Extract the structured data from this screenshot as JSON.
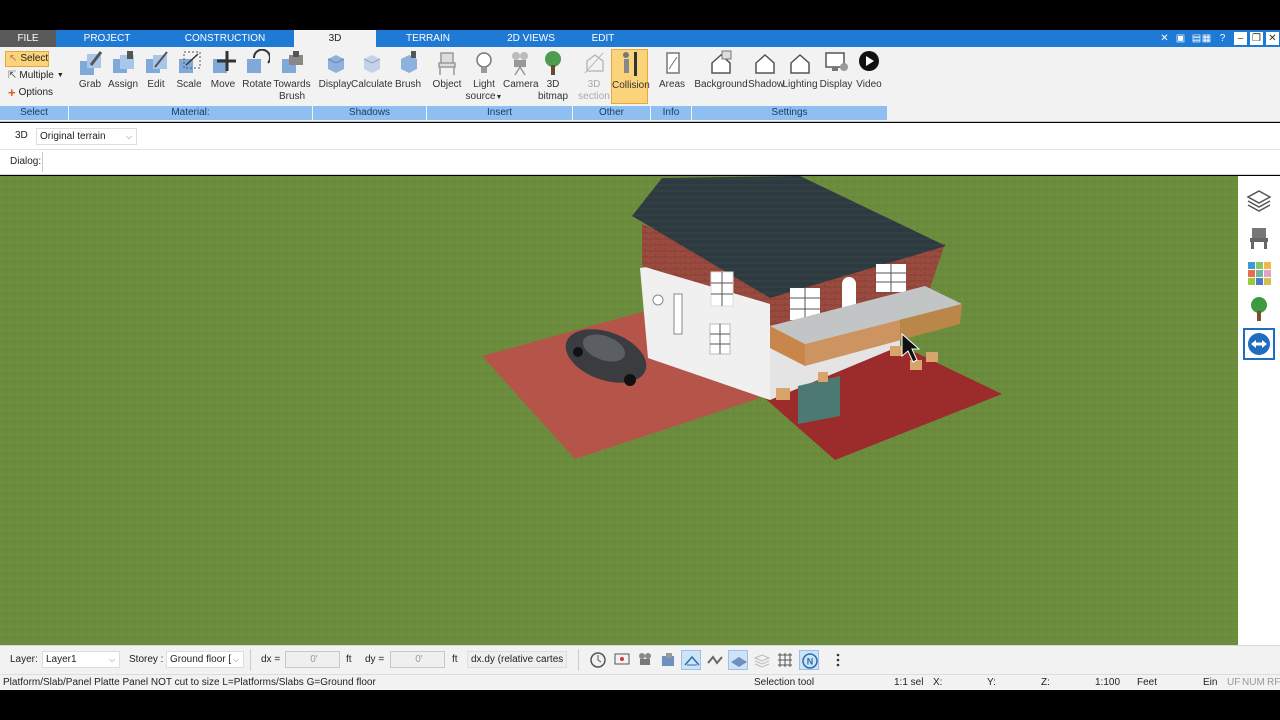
{
  "menu": {
    "tabs": [
      "FILE",
      "PROJECT",
      "CONSTRUCTION",
      "3D",
      "TERRAIN",
      "2D VIEWS",
      "EDIT"
    ],
    "active": "3D"
  },
  "ribbon": {
    "select": {
      "select_label": "Select",
      "multiple_label": "Multiple",
      "options_label": "Options",
      "group_label": "Select"
    },
    "material": {
      "grab": "Grab",
      "assign": "Assign",
      "edit": "Edit",
      "scale": "Scale",
      "move": "Move",
      "rotate": "Rotate",
      "towards_brush_1": "Towards",
      "towards_brush_2": "Brush",
      "group_label": "Material:"
    },
    "shadows": {
      "display": "Display",
      "calculate": "Calculate",
      "brush": "Brush",
      "group_label": "Shadows"
    },
    "insert": {
      "object": "Object",
      "light_1": "Light",
      "light_2": "source",
      "camera": "Camera",
      "bitmap_1": "3D",
      "bitmap_2": "bitmap",
      "group_label": "Insert"
    },
    "other": {
      "section_1": "3D",
      "section_2": "section",
      "collision": "Collision",
      "group_label": "Other"
    },
    "info": {
      "areas": "Areas",
      "group_label": "Info"
    },
    "settings": {
      "background": "Background",
      "shadow": "Shadow",
      "lighting": "Lighting",
      "display": "Display",
      "video": "Video",
      "group_label": "Settings"
    }
  },
  "view_bar": {
    "mode": "3D",
    "terrain_select": "Original terrain"
  },
  "dialog_bar": {
    "label": "Dialog:"
  },
  "bottom": {
    "layer_label": "Layer:",
    "layer_value": "Layer1",
    "storey_label": "Storey :",
    "storey_value": "Ground floor [",
    "dx_label": "dx =",
    "dx_value": "0'",
    "dx_unit": "ft",
    "dy_label": "dy =",
    "dy_value": "0'",
    "dy_unit": "ft",
    "coord_mode": "dx.dy (relative cartes"
  },
  "status": {
    "message": "Platform/Slab/Panel Platte Panel NOT cut to size L=Platforms/Slabs G=Ground floor",
    "tool": "Selection tool",
    "sel": "1:1 sel",
    "x": "X:",
    "y": "Y:",
    "z": "Z:",
    "scale": "1:100",
    "unit": "Feet",
    "ein": "Ein",
    "uf": "UF",
    "num": "NUM",
    "rf": "RF"
  },
  "colors": {
    "accent": "#1f7ad6",
    "group_label_bg": "#8ebff0",
    "active_button": "#fbd37a",
    "grass": "#6a8a3b"
  }
}
